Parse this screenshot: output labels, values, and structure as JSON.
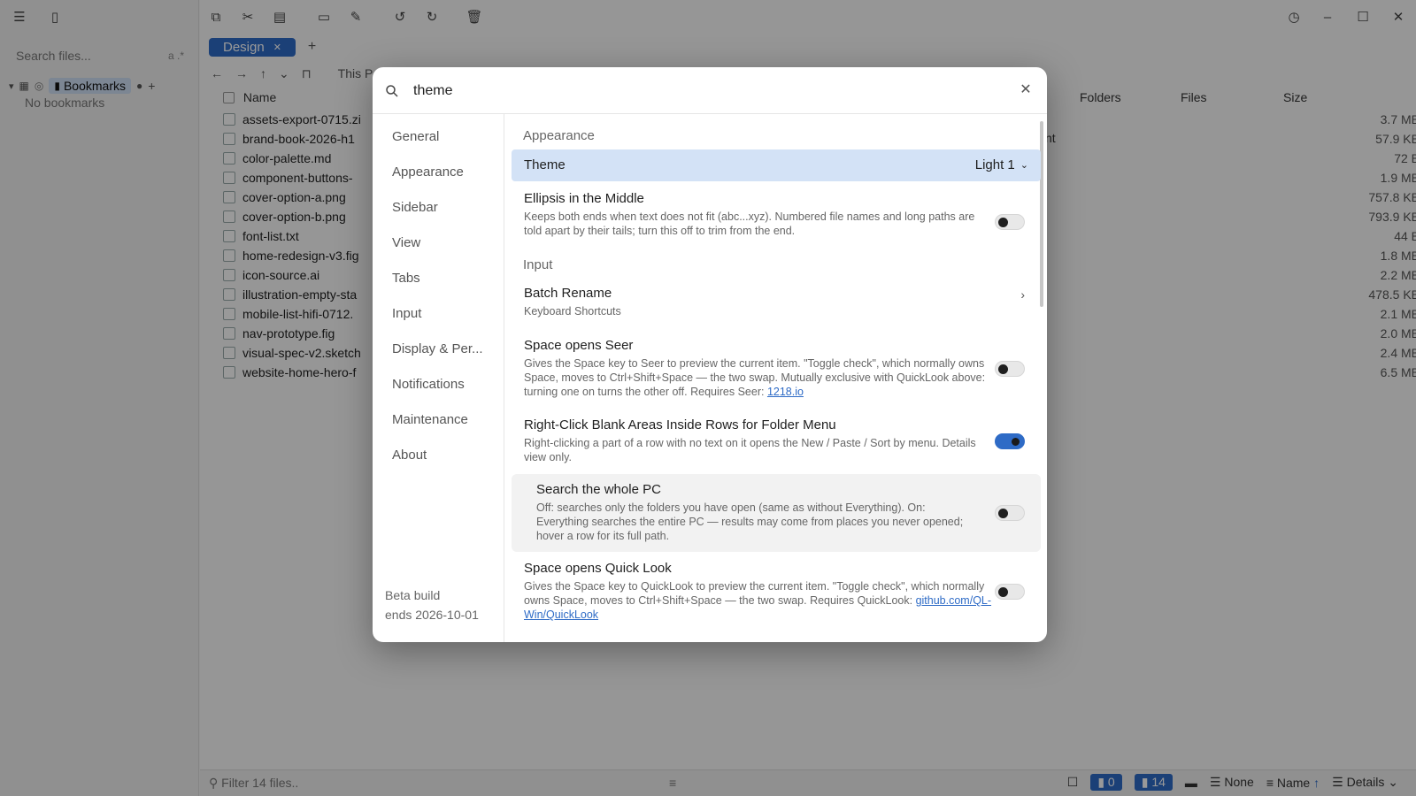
{
  "app": {
    "search_placeholder": "Search files...",
    "search_mods": "a  .*",
    "bookmarks_label": "Bookmarks",
    "no_bookmarks": "No bookmarks",
    "tab": {
      "label": "Design"
    },
    "breadcrumb": "This P",
    "columns": {
      "name": "Name",
      "folders": "Folders",
      "files": "Files",
      "size": "Size",
      "partial": "nt"
    },
    "files": [
      {
        "name": "assets-export-0715.zi",
        "size": "3.7 MB"
      },
      {
        "name": "brand-book-2026-h1",
        "size": "57.9 KB"
      },
      {
        "name": "color-palette.md",
        "size": "72 B"
      },
      {
        "name": "component-buttons-",
        "size": "1.9 MB"
      },
      {
        "name": "cover-option-a.png",
        "size": "757.8 KB"
      },
      {
        "name": "cover-option-b.png",
        "size": "793.9 KB"
      },
      {
        "name": "font-list.txt",
        "size": "44 B"
      },
      {
        "name": "home-redesign-v3.fig",
        "size": "1.8 MB"
      },
      {
        "name": "icon-source.ai",
        "size": "2.2 MB"
      },
      {
        "name": "illustration-empty-sta",
        "size": "478.5 KB"
      },
      {
        "name": "mobile-list-hifi-0712.",
        "size": "2.1 MB"
      },
      {
        "name": "nav-prototype.fig",
        "size": "2.0 MB"
      },
      {
        "name": "visual-spec-v2.sketch",
        "size": "2.4 MB"
      },
      {
        "name": "website-home-hero-f",
        "size": "6.5 MB"
      }
    ],
    "status": {
      "filter_placeholder": "Filter 14 files..",
      "folders_count": "0",
      "files_count": "14",
      "group": "None",
      "sort": "Name",
      "view": "Details"
    }
  },
  "settings": {
    "search_value": "theme",
    "nav": [
      "General",
      "Appearance",
      "Sidebar",
      "View",
      "Tabs",
      "Input",
      "Display & Per...",
      "Notifications",
      "Maintenance",
      "About"
    ],
    "beta": {
      "line1": "Beta build",
      "line2": "ends 2026-10-01"
    },
    "sections": {
      "appearance": "Appearance",
      "input": "Input"
    },
    "theme": {
      "title": "Theme",
      "value": "Light 1"
    },
    "ellipsis": {
      "title": "Ellipsis in the Middle",
      "desc": "Keeps both ends when text does not fit (abc...xyz). Numbered file names and long paths are told apart by their tails; turn this off to trim from the end."
    },
    "batch_rename": {
      "title": "Batch Rename",
      "sub": "Keyboard Shortcuts"
    },
    "space_seer": {
      "title": "Space opens Seer",
      "desc": "Gives the Space key to Seer to preview the current item. \"Toggle check\", which normally owns Space, moves to Ctrl+Shift+Space — the two swap. Mutually exclusive with QuickLook above: turning one on turns the other off. Requires Seer: ",
      "link": "1218.io"
    },
    "right_click": {
      "title": "Right-Click Blank Areas Inside Rows for Folder Menu",
      "desc": "Right-clicking a part of a row with no text on it opens the New / Paste / Sort by menu. Details view only."
    },
    "search_pc": {
      "title": "Search the whole PC",
      "desc": "Off: searches only the folders you have open (same as without Everything). On: Everything searches the entire PC — results may come from places you never opened; hover a row for its full path."
    },
    "quick_look": {
      "title": "Space opens Quick Look",
      "desc": "Gives the Space key to QuickLook to preview the current item. \"Toggle check\", which normally owns Space, moves to Ctrl+Shift+Space — the two swap. Requires QuickLook: ",
      "link": "github.com/QL-Win/QuickLook"
    }
  },
  "colors": {
    "accent": "#2e6bc6",
    "highlight": "#d3e2f6"
  }
}
